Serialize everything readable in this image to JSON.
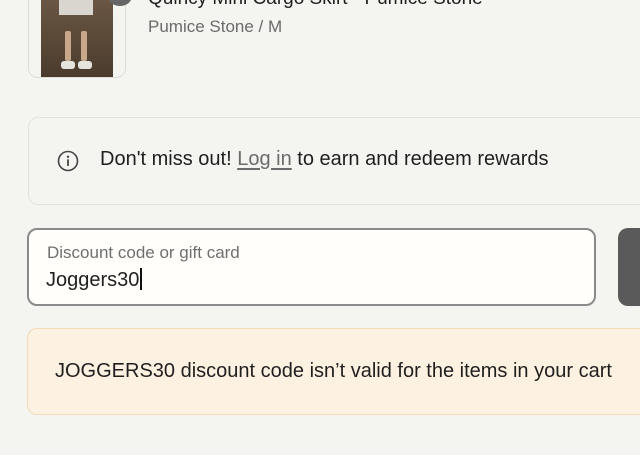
{
  "product": {
    "title": "Quincy Mini Cargo Skirt - Pumice Stone",
    "variant": "Pumice Stone / M"
  },
  "rewards": {
    "prefix": "Don't miss out! ",
    "login_link": "Log in",
    "suffix": " to earn and redeem rewards",
    "icon": "info-icon"
  },
  "discount": {
    "label": "Discount code or gift card",
    "value": "Joggers30"
  },
  "error": {
    "message": "JOGGERS30 discount code isn’t valid for the items in your cart"
  },
  "colors": {
    "background": "#f4f4f1",
    "error_background": "#fdf1e1",
    "error_border": "#f2d9b7",
    "apply_button": "#5a5a5a"
  }
}
